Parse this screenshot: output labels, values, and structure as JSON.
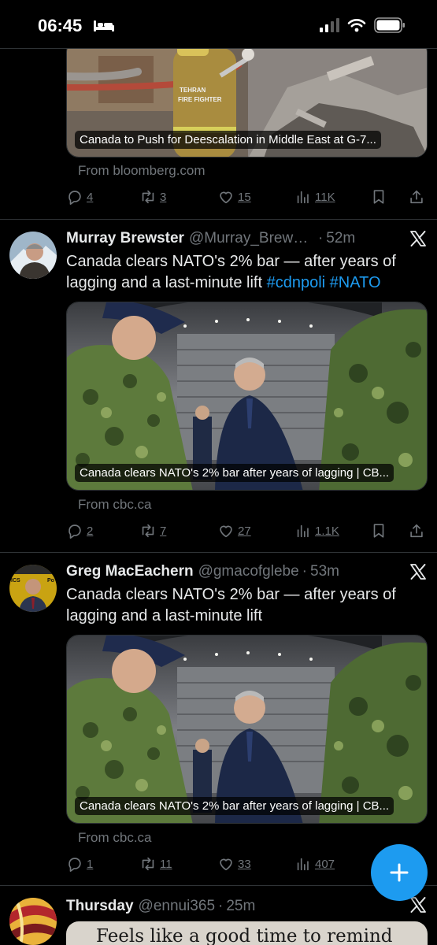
{
  "status_bar": {
    "time": "06:45"
  },
  "tweets": [
    {
      "card_caption": "Canada to Push for Deescalation in Middle East at G-7...",
      "source": "From bloomberg.com",
      "actions": {
        "replies": "4",
        "reposts": "3",
        "likes": "15",
        "views": "11K"
      },
      "image_label_1": "TEHRAN",
      "image_label_2": "FIRE FIGHTER"
    },
    {
      "name": "Murray Brewster",
      "handle": "@Murray_Brewst...",
      "dot": "·",
      "time": "52m",
      "text": "Canada clears NATO's 2% bar — after years of lagging and a last-minute lift ",
      "hashtags": [
        "#cdnpoli",
        "#NATO"
      ],
      "card_caption": "Canada clears NATO's 2% bar after years of lagging | CB...",
      "source": "From cbc.ca",
      "actions": {
        "replies": "2",
        "reposts": "7",
        "likes": "27",
        "views": "1.1K"
      }
    },
    {
      "name": "Greg MacEachern",
      "handle": "@gmacofglebe",
      "dot": "·",
      "time": "53m",
      "text": "Canada clears NATO's 2% bar — after years of lagging and a last-minute lift",
      "card_caption": "Canada clears NATO's 2% bar after years of lagging | CB...",
      "source": "From cbc.ca",
      "actions": {
        "replies": "1",
        "reposts": "11",
        "likes": "33",
        "views": "407"
      },
      "avatar_text_left": "ICS",
      "avatar_text_right": "Po"
    },
    {
      "name": "Thursday",
      "handle": "@ennui365",
      "dot": "·",
      "time": "25m",
      "card_text": "Feels like a good time to remind"
    }
  ],
  "icons": [
    "bed-icon",
    "signal-icon",
    "wifi-icon",
    "battery-icon",
    "x-logo-icon",
    "reply-icon",
    "repost-icon",
    "like-icon",
    "views-icon",
    "bookmark-icon",
    "share-icon",
    "compose-icon"
  ],
  "colors": {
    "accent": "#1d9bf0",
    "background": "#000000",
    "muted": "#71767b",
    "text": "#e7e9ea"
  }
}
